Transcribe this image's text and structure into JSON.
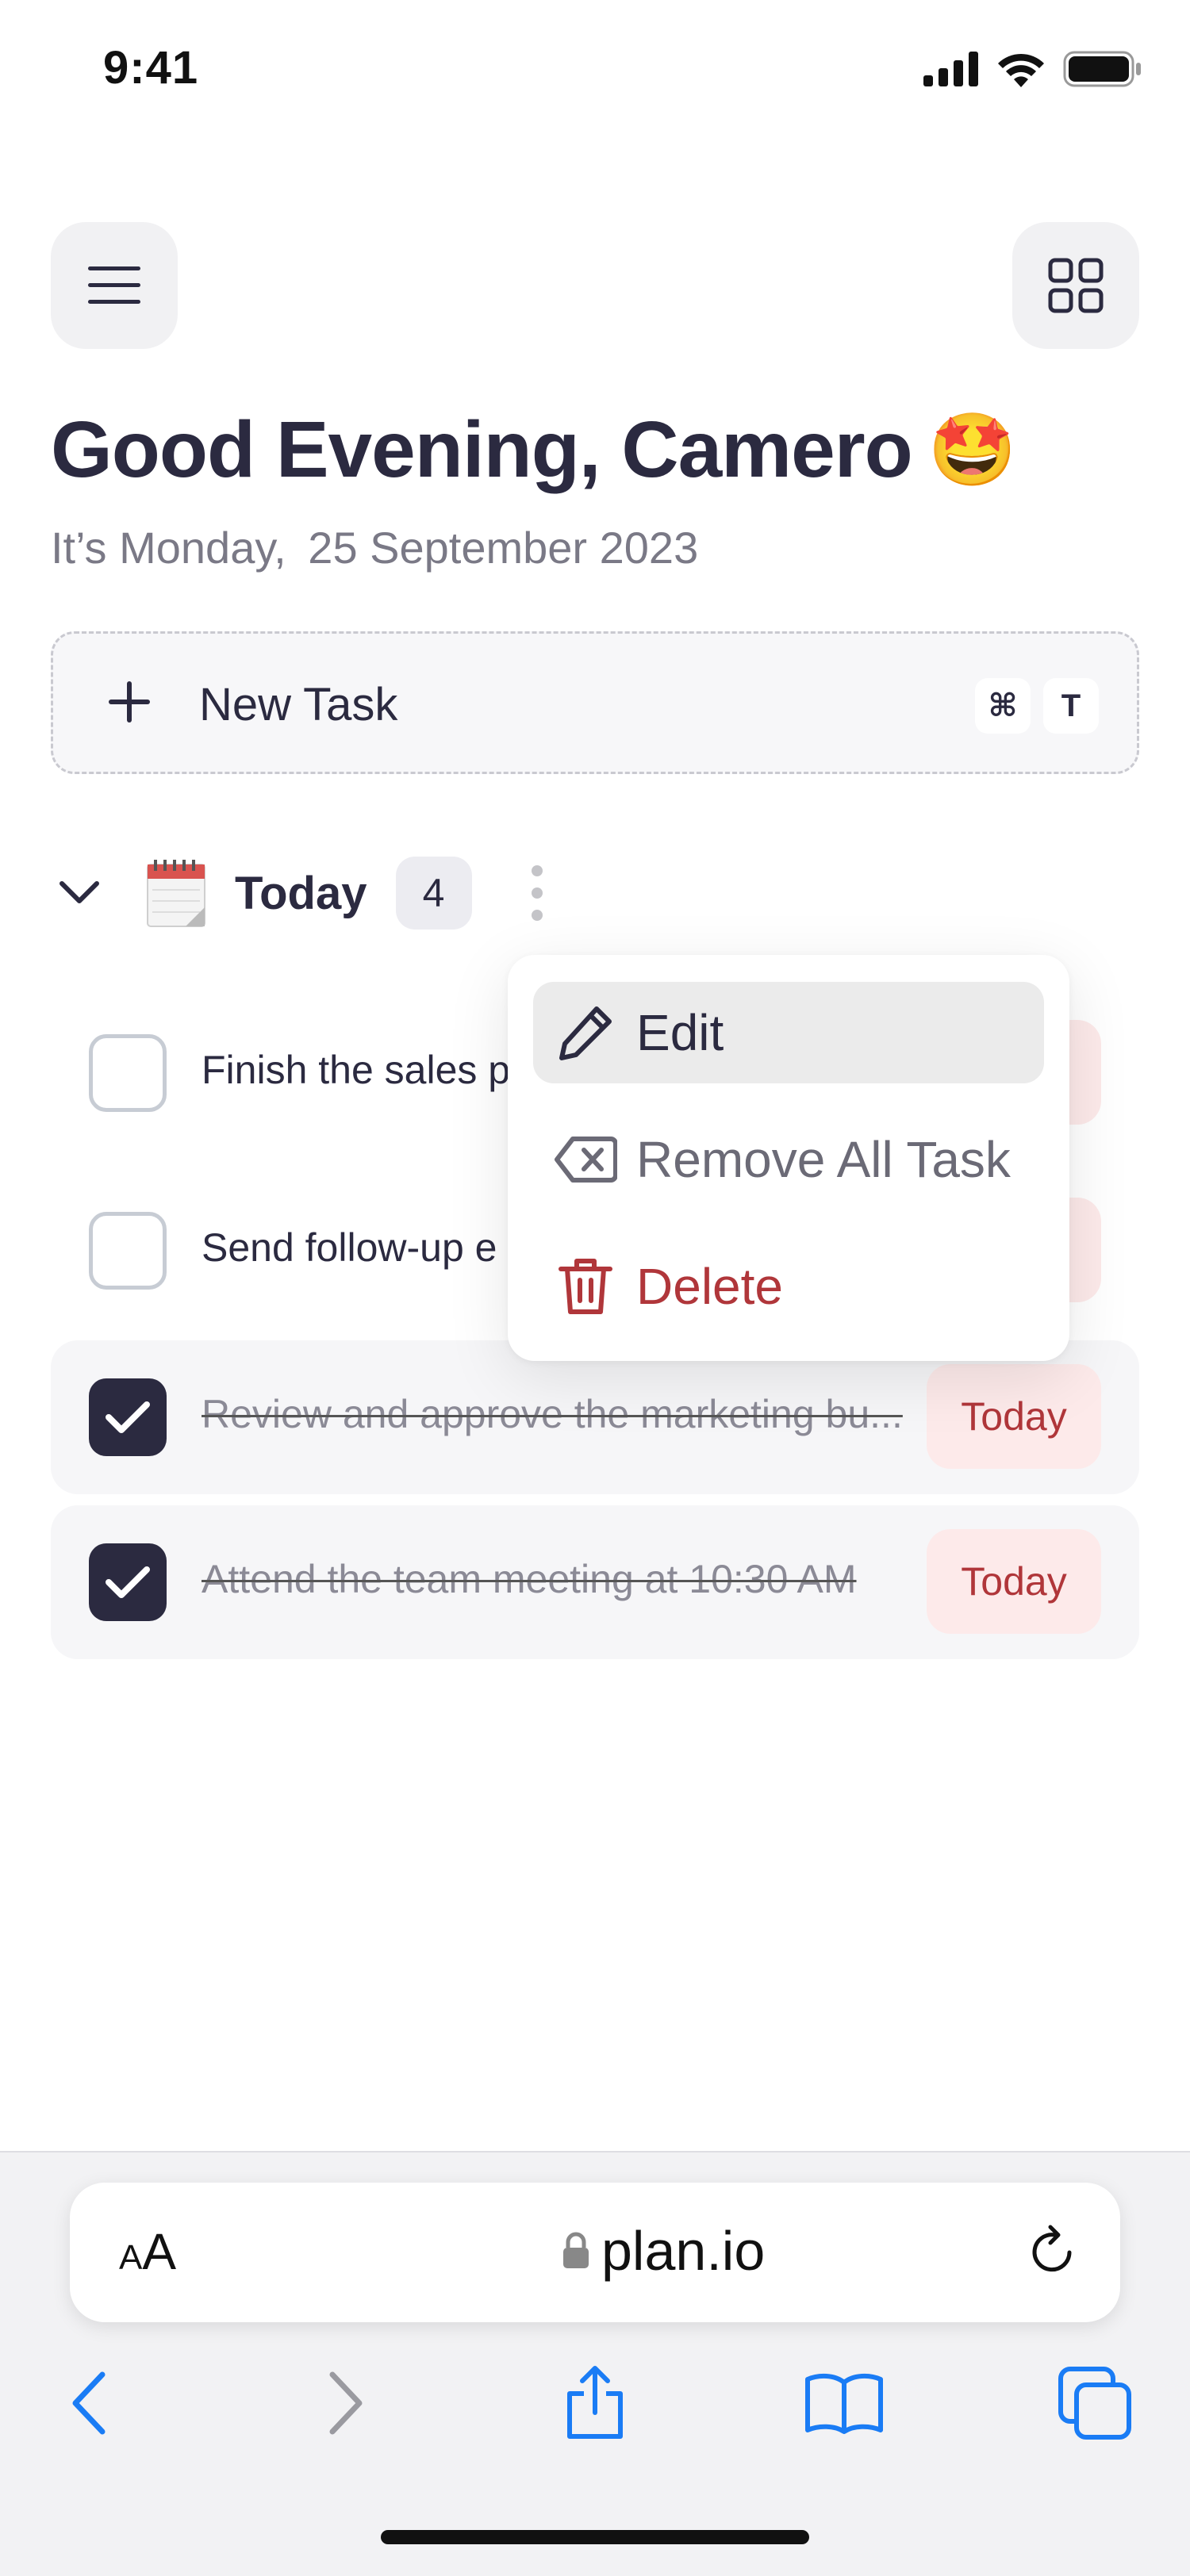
{
  "status_bar": {
    "time": "9:41"
  },
  "header": {
    "greeting": "Good Evening, Camero",
    "greeting_emoji": "🤩",
    "date_prefix": "It’s Monday,",
    "date": "25 September 2023"
  },
  "new_task": {
    "label": "New Task",
    "shortcut_cmd": "⌘",
    "shortcut_key": "T"
  },
  "section": {
    "title": "Today",
    "count": "4"
  },
  "tasks": [
    {
      "text": "Finish the sales pr",
      "done": false,
      "tag": ""
    },
    {
      "text": "Send follow-up e",
      "done": false,
      "tag": ""
    },
    {
      "text": "Review and approve the marketing bu...",
      "done": true,
      "tag": "Today"
    },
    {
      "text": "Attend the team meeting at 10:30 AM",
      "done": true,
      "tag": "Today"
    }
  ],
  "context_menu": {
    "edit": "Edit",
    "remove_all": "Remove All Task",
    "delete": "Delete"
  },
  "browser": {
    "aa_small": "A",
    "aa_large": "A",
    "url": "plan.io"
  },
  "colors": {
    "primary_dark": "#2b2a40",
    "danger": "#b0363a",
    "tag_bg": "#fdeaea",
    "ios_blue": "#1a7cf5"
  }
}
